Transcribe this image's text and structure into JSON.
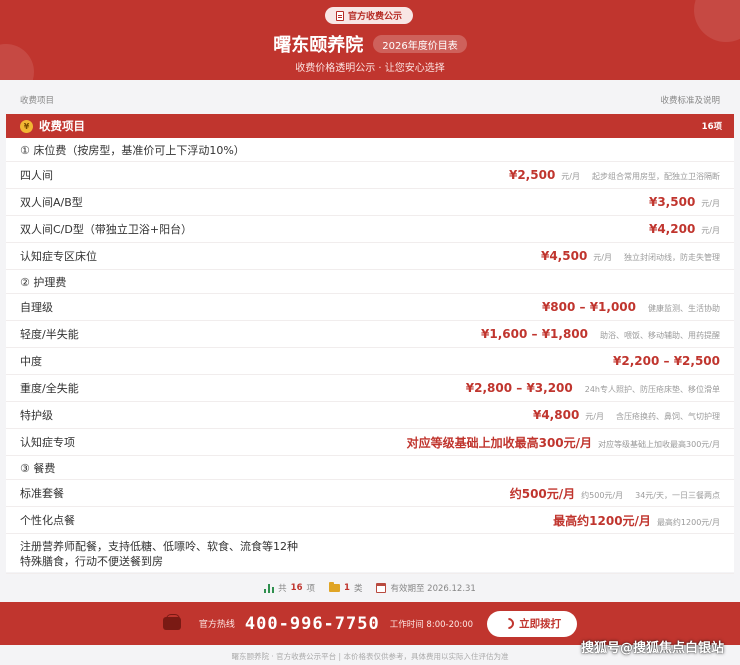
{
  "header": {
    "badge": "官方收费公示",
    "title": "曙东颐养院",
    "year_pill": "2026年度价目表",
    "subtitle": "收费价格透明公示 · 让您安心选择"
  },
  "columns": {
    "left": "收费项目",
    "right": "收费标准及说明"
  },
  "section": {
    "title": "收费项目",
    "count": "16项"
  },
  "rows": [
    {
      "kind": "category",
      "name": "① 床位费（按房型，基准价可上下浮动10%）"
    },
    {
      "kind": "item",
      "name": "四人间",
      "price": "¥2,500",
      "unit": "元/月",
      "note": "起步组合常用房型，配独立卫浴隔断"
    },
    {
      "kind": "item",
      "name": "双人间A/B型",
      "price": "¥3,500",
      "unit": "元/月",
      "note": ""
    },
    {
      "kind": "item",
      "name": "双人间C/D型（带独立卫浴+阳台）",
      "price": "¥4,200",
      "unit": "元/月",
      "note": ""
    },
    {
      "kind": "item",
      "name": "认知症专区床位",
      "price": "¥4,500",
      "unit": "元/月",
      "note": "独立封闭动线，防走失管理"
    },
    {
      "kind": "category",
      "name": "② 护理费"
    },
    {
      "kind": "item",
      "name": "自理级",
      "price": "¥800 – ¥1,000",
      "unit": "",
      "note": "健康监测、生活协助"
    },
    {
      "kind": "item",
      "name": "轻度/半失能",
      "price": "¥1,600 – ¥1,800",
      "unit": "",
      "note": "助浴、喂饭、移动辅助、用药提醒"
    },
    {
      "kind": "item",
      "name": "中度",
      "price": "¥2,200 – ¥2,500",
      "unit": "",
      "note": ""
    },
    {
      "kind": "item",
      "name": "重度/全失能",
      "price": "¥2,800 – ¥3,200",
      "unit": "",
      "note": "24h专人照护、防压疮床垫、移位滑单"
    },
    {
      "kind": "item",
      "name": "特护级",
      "price": "¥4,800",
      "unit": "元/月",
      "note": "含压疮换药、鼻饲、气切护理"
    },
    {
      "kind": "item",
      "name": "认知症专项",
      "price": "对应等级基础上加收最高300元/月",
      "unit": "对应等级基础上加收最高300元/月",
      "note": ""
    },
    {
      "kind": "category",
      "name": "③ 餐费"
    },
    {
      "kind": "item",
      "name": "标准套餐",
      "price": "约500元/月",
      "unit": "约500元/月",
      "note": "34元/天，一日三餐两点"
    },
    {
      "kind": "item",
      "name": "个性化点餐",
      "price": "最高约1200元/月",
      "unit": "最高约1200元/月",
      "note": ""
    },
    {
      "kind": "tall",
      "name": "注册营养师配餐，支持低糖、低嘌呤、软食、流食等12种特殊膳食，行动不便送餐到房"
    }
  ],
  "summary": {
    "total_prefix": "共",
    "total_num": "16",
    "total_suffix": "项",
    "cat_num": "1",
    "cat_suffix": "类",
    "valid": "有效期至 2026.12.31"
  },
  "footer": {
    "hotline_label": "官方热线",
    "hotline": "400-996-7750",
    "hours": "工作时间 8:00-20:00",
    "call_button": "立即拨打"
  },
  "bottom_note": "曙东颐养院 · 官方收费公示平台 | 本价格表仅供参考，具体费用以实际入住评估为准",
  "watermark": "搜狐号@搜狐焦点白银站",
  "colors": {
    "primary": "#c0352e",
    "badge_text": "#b62d27",
    "bg": "#f4f4f6"
  }
}
